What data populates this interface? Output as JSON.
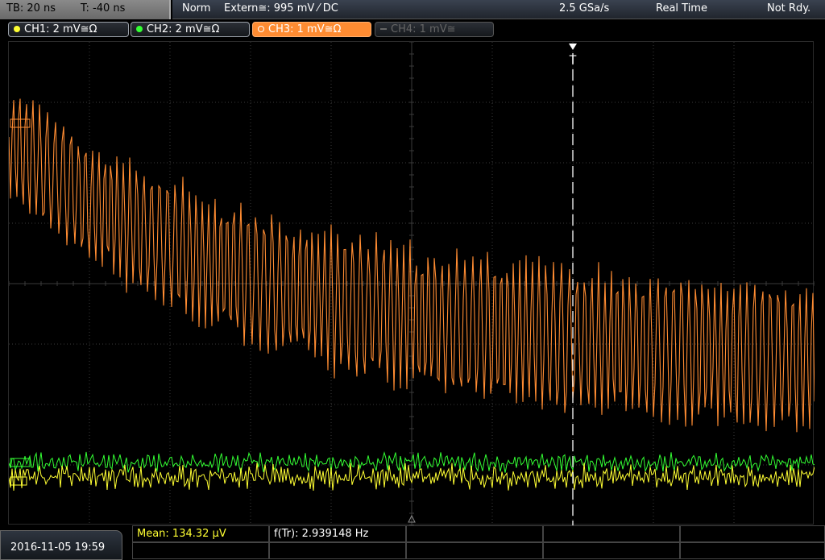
{
  "topbar": {
    "timebase": "TB: 20 ns",
    "trigger_pos": "T: -40 ns",
    "mode": "Norm",
    "trigger_source": "Extern≅: 995 mV ⁄ DC",
    "sample_rate": "2.5 GSa/s",
    "acq_mode": "Real Time",
    "status": "Not Rdy."
  },
  "channels": [
    {
      "label": "CH1: 2 mV≅Ω",
      "color": "#ffff33",
      "state": "on"
    },
    {
      "label": "CH2: 2 mV≅Ω",
      "color": "#33ff33",
      "state": "on"
    },
    {
      "label": "CH3: 1 mV≅Ω",
      "color": "#ff8c32",
      "state": "active"
    },
    {
      "label": "CH4: 1 mV≅",
      "color": "#555555",
      "state": "off"
    }
  ],
  "trigger_marker": "T",
  "bottom": {
    "datetime": "2016-11-05 19:59",
    "meas1": "Mean: 134.32 µV",
    "meas2": "f(Tr): 2.939148 Hz"
  },
  "colors": {
    "ch1": "#ffff33",
    "ch2": "#33ff33",
    "ch3": "#ff8c32",
    "grid": "#3a3a3a"
  }
}
